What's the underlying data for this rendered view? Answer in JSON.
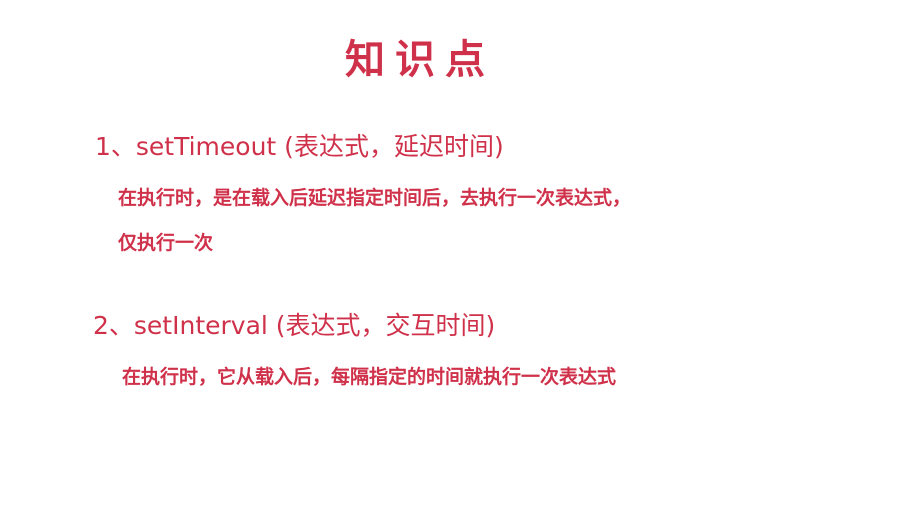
{
  "slide": {
    "title": "知识点",
    "items": [
      {
        "heading": "1、setTimeout (表达式，延迟时间)",
        "description_lines": [
          "在执行时，是在载入后延迟指定时间后，去执行一次表达式，",
          "仅执行一次"
        ]
      },
      {
        "heading": "2、setInterval (表达式，交互时间)",
        "description_lines": [
          "在执行时，它从载入后，每隔指定的时间就执行一次表达式"
        ]
      }
    ]
  },
  "colors": {
    "text": "#d0314a",
    "background": "#ffffff"
  }
}
